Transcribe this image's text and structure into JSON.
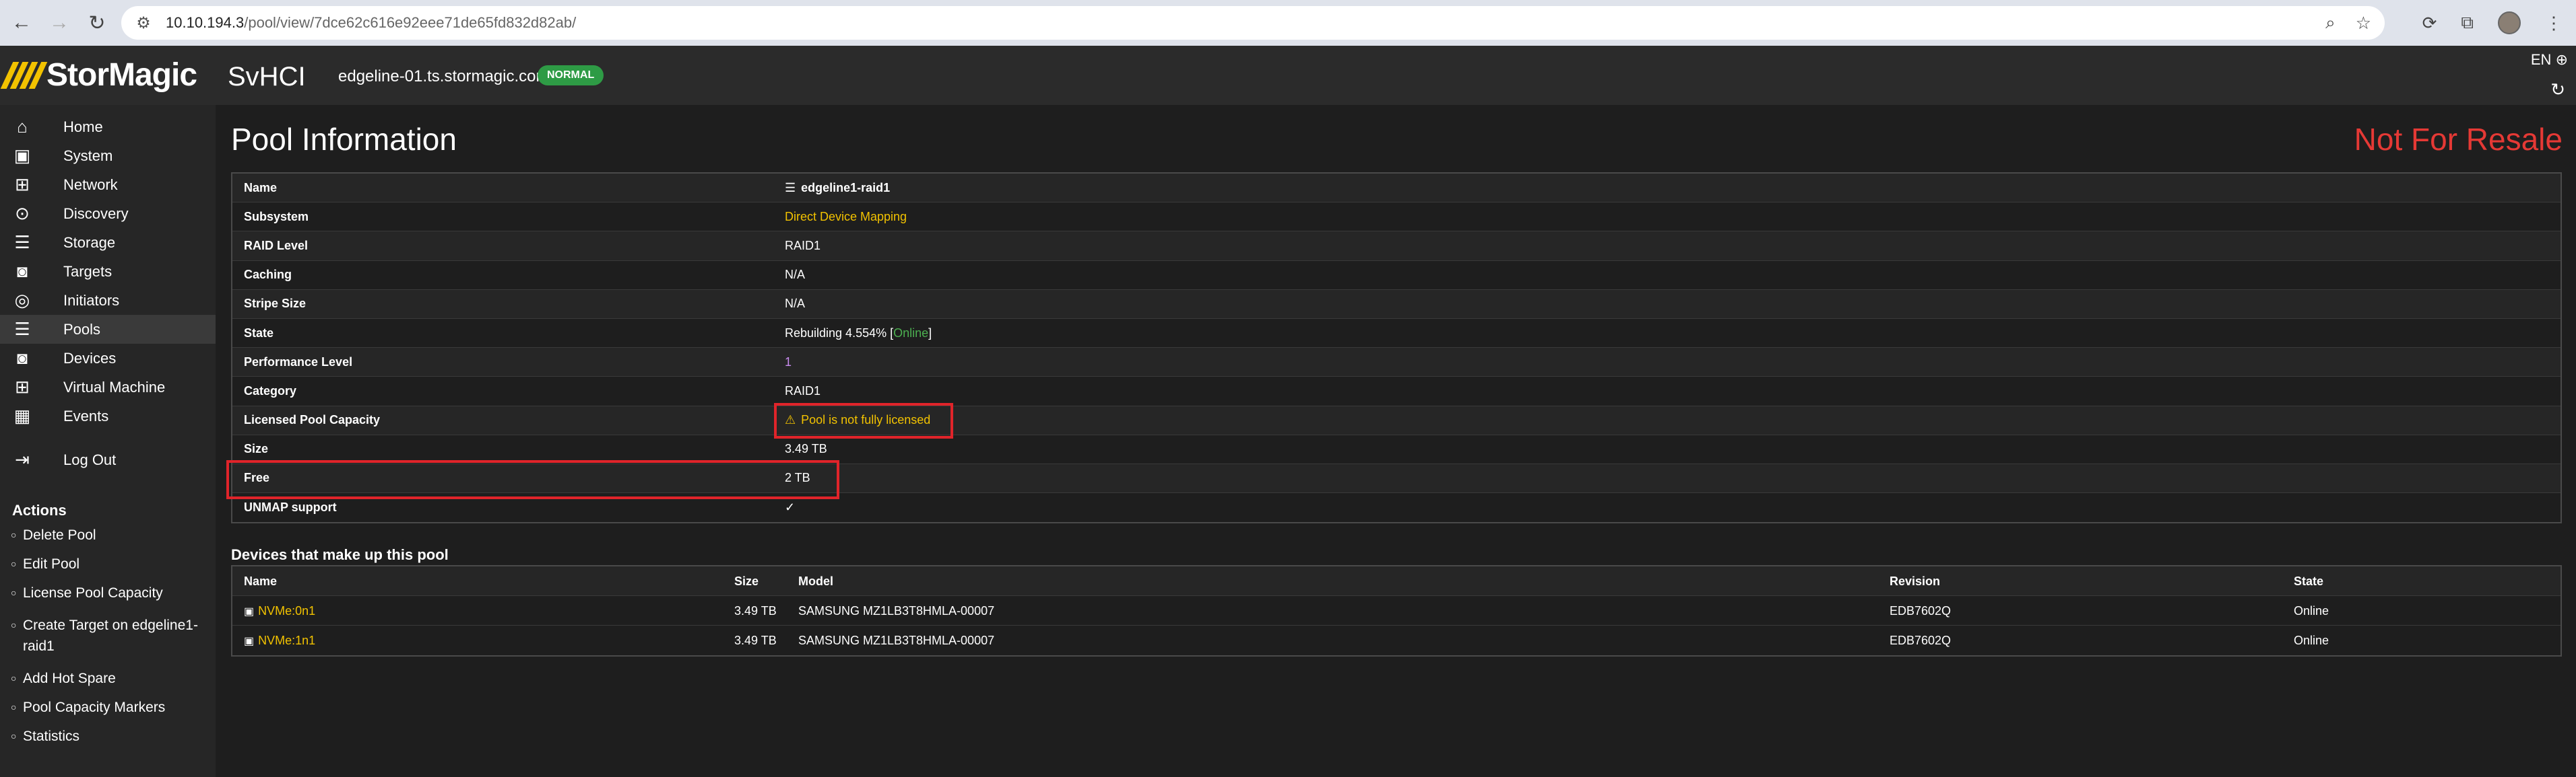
{
  "browser": {
    "url_host": "10.10.194.3",
    "url_path": "/pool/view/7dce62c616e92eee71de65fd832d82ab/"
  },
  "header": {
    "logo_text": "StorMagic",
    "product": "SvHCI",
    "hostname": "edgeline-01.ts.stormagic.com",
    "status_badge": "NORMAL",
    "language": "EN",
    "badge_color": "#2e9b45"
  },
  "sidebar": {
    "items": [
      {
        "label": "Home",
        "icon": "home-icon"
      },
      {
        "label": "System",
        "icon": "system-icon"
      },
      {
        "label": "Network",
        "icon": "network-icon"
      },
      {
        "label": "Discovery",
        "icon": "discovery-icon"
      },
      {
        "label": "Storage",
        "icon": "storage-icon"
      },
      {
        "label": "Targets",
        "icon": "targets-icon"
      },
      {
        "label": "Initiators",
        "icon": "initiators-icon"
      },
      {
        "label": "Pools",
        "icon": "pools-icon"
      },
      {
        "label": "Devices",
        "icon": "devices-icon"
      },
      {
        "label": "Virtual Machine",
        "icon": "vm-icon"
      },
      {
        "label": "Events",
        "icon": "calendar-icon"
      },
      {
        "label": "Log Out",
        "icon": "logout-icon"
      }
    ],
    "active_item": "Pools",
    "actions_title": "Actions",
    "actions": [
      "Delete Pool",
      "Edit Pool",
      "License Pool Capacity",
      "Create Target on edgeline1-raid1",
      "Add Hot Spare",
      "Pool Capacity Markers",
      "Statistics"
    ]
  },
  "main": {
    "title": "Pool Information",
    "watermark": "Not For Resale",
    "info": {
      "name_label": "Name",
      "name_value": "edgeline1-raid1",
      "subsystem_label": "Subsystem",
      "subsystem_value": "Direct Device Mapping",
      "raid_label": "RAID Level",
      "raid_value": "RAID1",
      "caching_label": "Caching",
      "caching_value": "N/A",
      "stripe_label": "Stripe Size",
      "stripe_value": "N/A",
      "state_label": "State",
      "state_value": "Rebuilding 4.554% [",
      "state_status": "Online",
      "state_suffix": "]",
      "perf_label": "Performance Level",
      "perf_value": "1",
      "category_label": "Category",
      "category_value": "RAID1",
      "licensed_label": "Licensed Pool Capacity",
      "licensed_value": "Pool is not fully licensed",
      "size_label": "Size",
      "size_value": "3.49 TB",
      "free_label": "Free",
      "free_value": "2 TB",
      "unmap_label": "UNMAP support",
      "unmap_value": "✓"
    },
    "devices_title": "Devices that make up this pool",
    "devices_headers": [
      "Name",
      "Size",
      "Model",
      "Revision",
      "State"
    ],
    "devices": [
      {
        "name": "NVMe:0n1",
        "size": "3.49 TB",
        "model": "SAMSUNG MZ1LB3T8HMLA-00007",
        "revision": "EDB7602Q",
        "state": "Online"
      },
      {
        "name": "NVMe:1n1",
        "size": "3.49 TB",
        "model": "SAMSUNG MZ1LB3T8HMLA-00007",
        "revision": "EDB7602Q",
        "state": "Online"
      }
    ]
  }
}
